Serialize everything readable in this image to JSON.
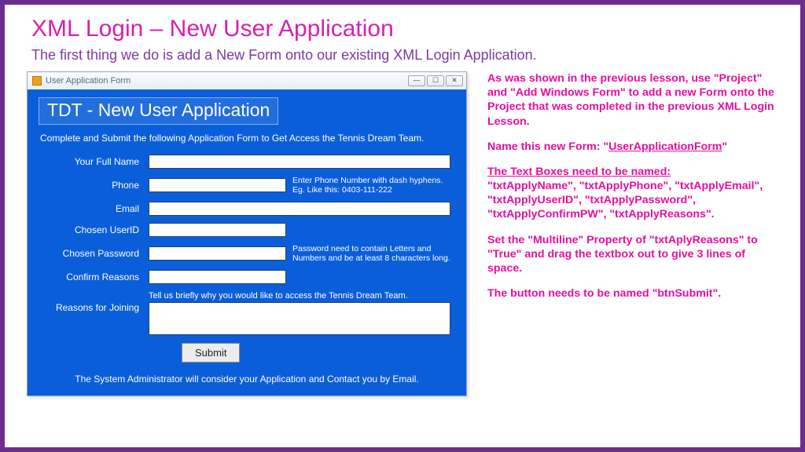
{
  "slide": {
    "title": "XML Login – New User Application",
    "subtitle": "The first thing we do is add a New Form onto our existing XML Login Application."
  },
  "window": {
    "caption": "User Application Form",
    "min": "—",
    "max": "☐",
    "close": "✕",
    "heading": "TDT - New User Application",
    "instructions": "Complete and Submit the following Application Form to Get Access the Tennis Dream Team.",
    "labels": {
      "name": "Your Full Name",
      "phone": "Phone",
      "email": "Email",
      "userid": "Chosen UserID",
      "password": "Chosen Password",
      "confirm": "Confirm Reasons",
      "reasons": "Reasons for Joining"
    },
    "hints": {
      "phone": "Enter Phone Number with dash hyphens. Eg. Like this: 0403-111-222",
      "password": "Password need to contain Letters and Numbers and be at least 8 characters long.",
      "reasons": "Tell us briefly why you would like to access the Tennis Dream Team."
    },
    "submit": "Submit",
    "footer": "The System Administrator will consider your Application and Contact you by Email."
  },
  "notes": {
    "p1": "As was shown in the previous lesson, use \"Project\" and \"Add Windows Form\" to add a new Form onto the Project that was completed in the previous XML Login Lesson.",
    "p2_prefix": "Name this new Form: \"",
    "p2_name": "UserApplicationForm",
    "p2_suffix": "\"",
    "p3_head": "The Text Boxes need to be named:",
    "p3_body": "\"txtApplyName\", \"txtApplyPhone\", \"txtApplyEmail\", \"txtApplyUserID\", \"txtApplyPassword\", \"txtApplyConfirmPW\", \"txtApplyReasons\".",
    "p4": "Set the \"Multiline\" Property of \"txtAplyReasons\" to \"True\" and drag the textbox out to give 3 lines of space.",
    "p5": "The button needs to be named \"btnSubmit\"."
  }
}
